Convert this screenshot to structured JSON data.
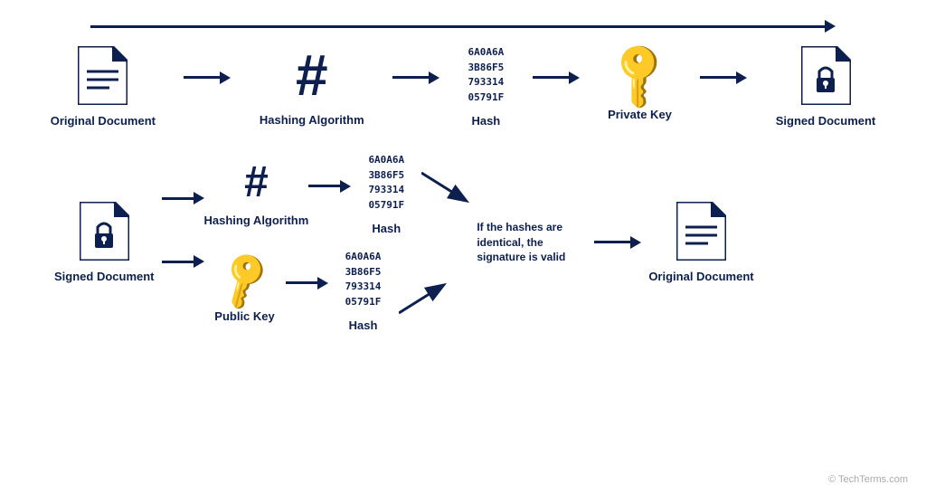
{
  "top": {
    "items": [
      {
        "id": "original-doc",
        "label": "Original Document"
      },
      {
        "id": "hashing-algo",
        "label": "Hashing Algorithm"
      },
      {
        "id": "hash1",
        "label": "Hash",
        "code": "6A0A6A\n3B86F5\n793314\n05791F"
      },
      {
        "id": "private-key",
        "label": "Private Key"
      },
      {
        "id": "signed-doc",
        "label": "Signed Document"
      }
    ],
    "long_arrow_label": ""
  },
  "bottom": {
    "left_item": {
      "label": "Signed Document"
    },
    "top_path": {
      "hash_algo_label": "Hashing Algorithm",
      "hash_label": "Hash",
      "hash_code": "6A0A6A\n3B86F5\n793314\n05791F"
    },
    "bottom_path": {
      "key_label": "Public Key",
      "hash_label": "Hash",
      "hash_code": "6A0A6A\n3B86F5\n793314\n05791F"
    },
    "condition": "If the hashes are identical, the signature is valid",
    "right_item": {
      "label": "Original Document"
    }
  },
  "watermark": "© TechTerms.com"
}
